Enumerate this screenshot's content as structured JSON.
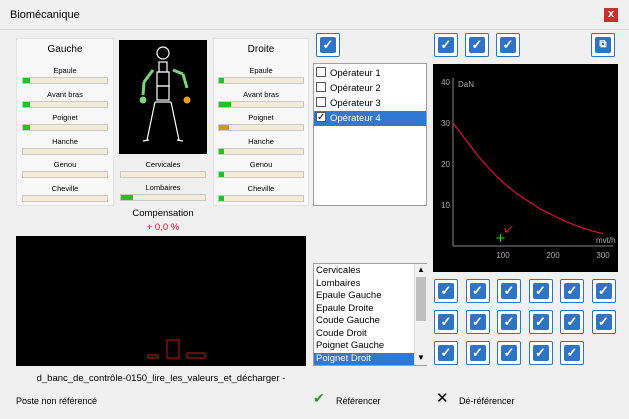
{
  "window": {
    "title": "Biomécanique",
    "close_glyph": "x"
  },
  "left": {
    "header": "Gauche",
    "items": [
      {
        "label": "Epaule",
        "fill": 0.08,
        "color": "#22c222"
      },
      {
        "label": "Avant bras",
        "fill": 0.08,
        "color": "#22c222"
      },
      {
        "label": "Poignet",
        "fill": 0.08,
        "color": "#22c222"
      },
      {
        "label": "Hanche",
        "fill": 0.0,
        "color": "#22c222"
      },
      {
        "label": "Genou",
        "fill": 0.0,
        "color": "#22c222"
      },
      {
        "label": "Cheville",
        "fill": 0.0,
        "color": "#22c222"
      }
    ]
  },
  "right": {
    "header": "Droite",
    "items": [
      {
        "label": "Epaule",
        "fill": 0.06,
        "color": "#22c222"
      },
      {
        "label": "Avant bras",
        "fill": 0.14,
        "color": "#22c222"
      },
      {
        "label": "Poignet",
        "fill": 0.12,
        "color": "#c8a000"
      },
      {
        "label": "Hanche",
        "fill": 0.06,
        "color": "#22c222"
      },
      {
        "label": "Genou",
        "fill": 0.06,
        "color": "#22c222"
      },
      {
        "label": "Cheville",
        "fill": 0.06,
        "color": "#22c222"
      }
    ]
  },
  "spine": {
    "items": [
      {
        "label": "Cervicales",
        "fill": 0.0,
        "color": "#22c222"
      },
      {
        "label": "Lombaires",
        "fill": 0.14,
        "color": "#22c222"
      }
    ]
  },
  "compensation": {
    "label": "Compensation",
    "value": "+ 0,0 %"
  },
  "operators": {
    "items": [
      {
        "label": "Opérateur 1",
        "checked": false,
        "selected": false
      },
      {
        "label": "Opérateur 2",
        "checked": false,
        "selected": false
      },
      {
        "label": "Opérateur 3",
        "checked": false,
        "selected": false
      },
      {
        "label": "Opérateur 4",
        "checked": true,
        "selected": true
      }
    ]
  },
  "chart_data": {
    "type": "line",
    "ylabel": "DaN",
    "xlabel": "mvt/h",
    "xlim": [
      0,
      300
    ],
    "ylim": [
      0,
      40
    ],
    "xticks": [
      "100",
      "200",
      "300"
    ],
    "yticks": [
      "10",
      "20",
      "30",
      "40"
    ],
    "series": [
      {
        "color": "#e0102a",
        "x": [
          0,
          25,
          50,
          75,
          100,
          125,
          150,
          175,
          200,
          225,
          250,
          275,
          300
        ],
        "y": [
          30,
          26,
          22,
          18.5,
          15.5,
          13,
          11,
          9,
          7.5,
          6,
          4.8,
          3.8,
          3
        ]
      }
    ],
    "marker": {
      "x": 95,
      "y": 1,
      "color": "#22c222"
    }
  },
  "segments": [
    "Cervicales",
    "Lombaires",
    "Epaule Gauche",
    "Epaule Droite",
    "Coude Gauche",
    "Coude Droit",
    "Poignet Gauche",
    "Poignet Droit"
  ],
  "selected_segment": 7,
  "file_caption": "d_banc_de_contrôle-0150_lire_les_valeurs_et_décharger -",
  "status": "Poste non référencé",
  "buttons": {
    "reference": "Référencer",
    "dereference": "Dé-référencer"
  }
}
